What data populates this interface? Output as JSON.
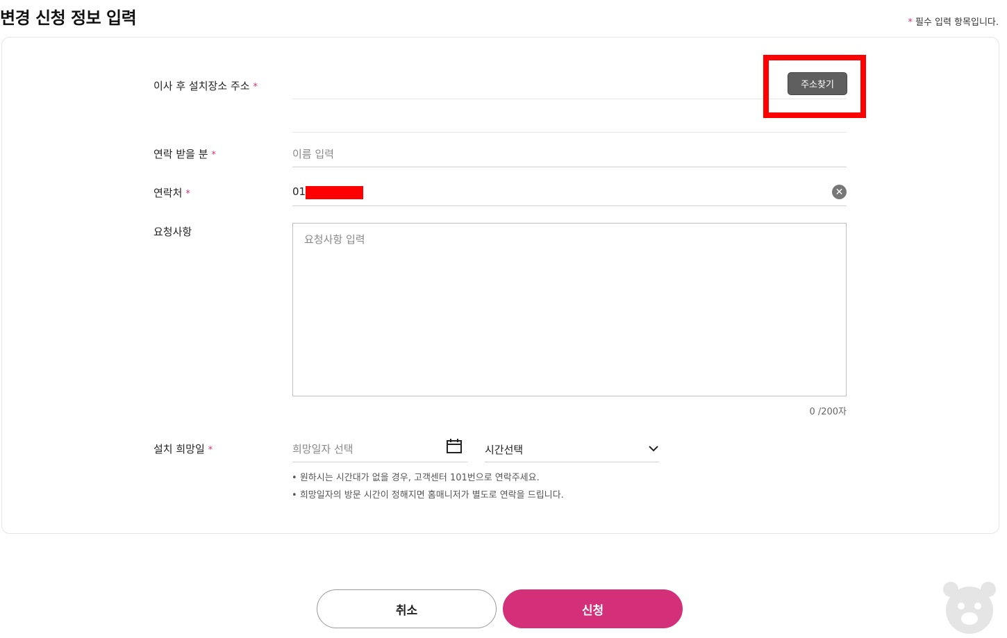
{
  "header": {
    "title": "변경 신청 정보 입력",
    "required_note": "필수 입력 항목입니다.",
    "required_mark": "*"
  },
  "form": {
    "address": {
      "label": "이사 후 설치장소 주소",
      "button_label": "주소찾기"
    },
    "recipient": {
      "label": "연락 받을 분",
      "placeholder": "이름 입력"
    },
    "phone": {
      "label": "연락처",
      "value": "01"
    },
    "request": {
      "label": "요청사항",
      "placeholder": "요청사항 입력",
      "counter": "0 /200자"
    },
    "install_date": {
      "label": "설치 희망일",
      "date_placeholder": "희망일자 선택",
      "time_selected": "시간선택",
      "notes": [
        "원하시는 시간대가 없을 경우, 고객센터 101번으로 연락주세요.",
        "희망일자의 방문 시간이 정해지면 홈매니저가 별도로 연락을 드립니다."
      ]
    }
  },
  "actions": {
    "cancel_label": "취소",
    "submit_label": "신청"
  },
  "colors": {
    "accent": "#d4307a",
    "highlight": "#ff0000"
  },
  "icons": [
    "clear-icon",
    "calendar-icon",
    "chevron-down-icon",
    "bear-mascot-icon"
  ]
}
